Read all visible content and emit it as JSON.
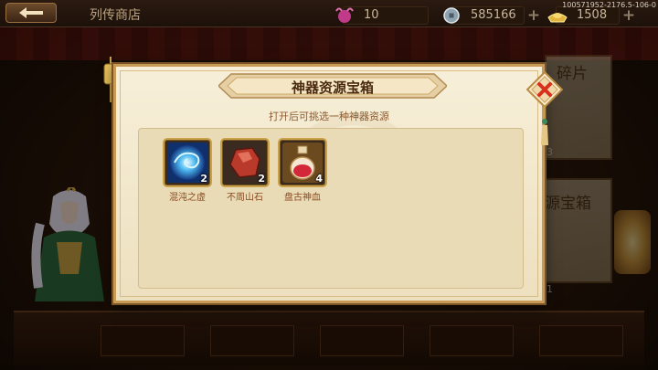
{
  "header": {
    "shop_title": "列传商店",
    "back_icon": "back-arrow-icon",
    "build_id": "100571952-2176.5-106-0"
  },
  "resources": [
    {
      "name": "pet-ticket",
      "icon": "crab-ticket-icon",
      "value": "10"
    },
    {
      "name": "silver",
      "icon": "coin-icon",
      "value": "585166"
    },
    {
      "name": "gold",
      "icon": "gold-ingot-icon",
      "value": "1508"
    }
  ],
  "modal": {
    "title": "神器资源宝箱",
    "subtitle": "打开后可挑选一种神器资源",
    "close_icon": "close-x-icon",
    "items": [
      {
        "name": "混沌之虚",
        "count": "2",
        "icon": "chaos-void-orb-icon"
      },
      {
        "name": "不周山石",
        "count": "2",
        "icon": "buzhou-mountain-stone-icon"
      },
      {
        "name": "盘古神血",
        "count": "4",
        "icon": "pangu-blood-bottle-icon"
      }
    ]
  },
  "background": {
    "right_label_1": "碎片",
    "right_label_2": "源宝箱",
    "right_count_1": "3",
    "right_count_2": "1"
  },
  "colors": {
    "modal_bg": "#f3e9d0",
    "modal_border": "#c79b55",
    "title_text": "#4a2b10",
    "subtitle_text": "#8a5a30",
    "item_name_text": "#8a4a20",
    "close_button_red": "#d9301e"
  }
}
